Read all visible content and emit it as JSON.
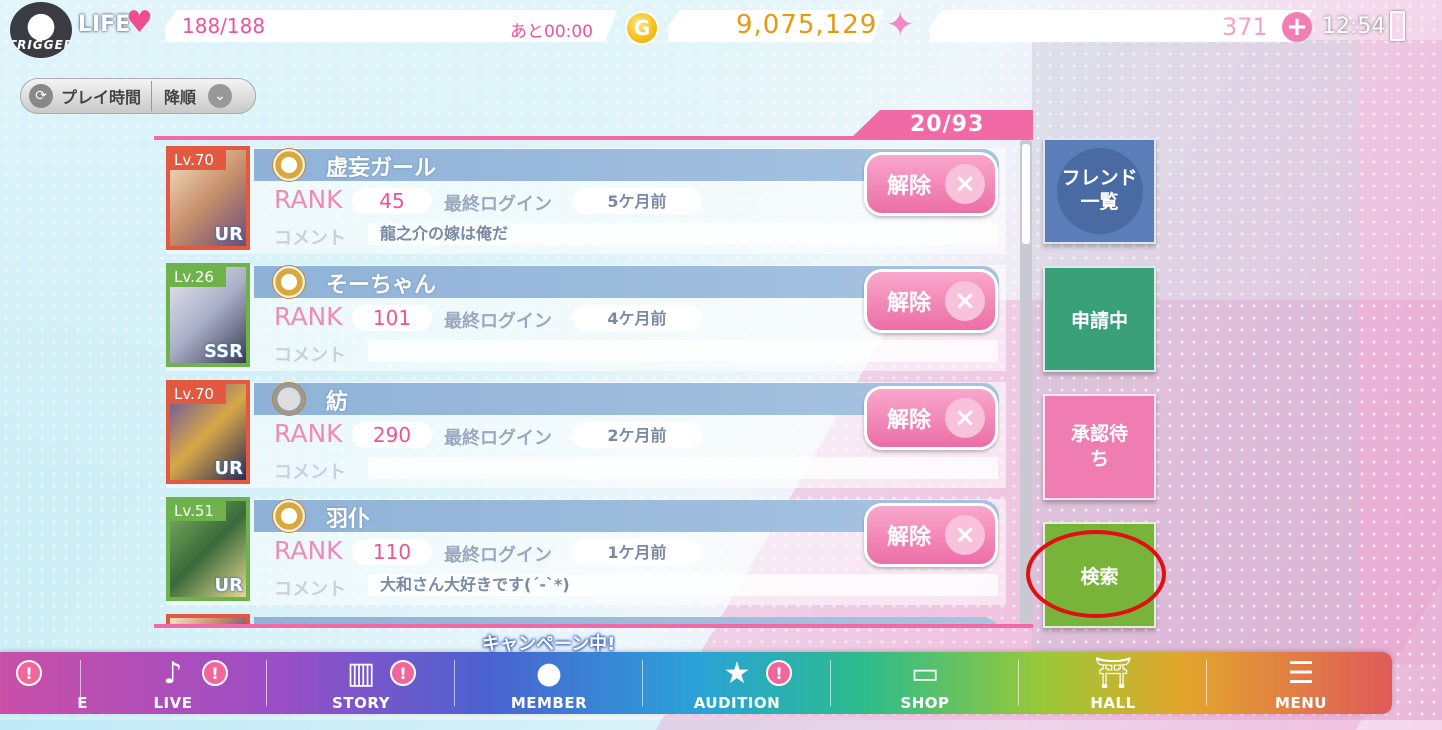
{
  "header": {
    "avatar_text": "TRIGGER",
    "life_label": "LIFE",
    "life_value": "188/188",
    "life_timer": "あと00:00",
    "gold_icon": "G",
    "gold": "9,075,129",
    "gems": "371",
    "gem_plus": "+",
    "clock": "12:54"
  },
  "sort": {
    "field_label": "プレイ時間",
    "order_label": "降順"
  },
  "list": {
    "counter": "20/93",
    "rank_label": "RANK",
    "login_label": "最終ログイン",
    "comment_label": "コメント",
    "remove_label": "解除",
    "remove_icon": "×",
    "friends": [
      {
        "level": "Lv.70",
        "rarity": "UR",
        "name": "虚妄ガール",
        "rank": "45",
        "last_login": "5ケ月前",
        "comment": "龍之介の嫁は俺だ"
      },
      {
        "level": "Lv.26",
        "rarity": "SSR",
        "name": "そーちゃん",
        "rank": "101",
        "last_login": "4ケ月前",
        "comment": ""
      },
      {
        "level": "Lv.70",
        "rarity": "UR",
        "name": "紡",
        "rank": "290",
        "last_login": "2ケ月前",
        "comment": ""
      },
      {
        "level": "Lv.51",
        "rarity": "UR",
        "name": "羽仆",
        "rank": "110",
        "last_login": "1ケ月前",
        "comment": "大和さん大好きです(´-`*)"
      }
    ]
  },
  "side": {
    "friends_list": "フレンド一覧",
    "applying": "申請中",
    "pending": "承認待ち",
    "search": "検索"
  },
  "nav": {
    "campaign": "キャンペーン中!",
    "badge": "!",
    "items": [
      {
        "label": "E"
      },
      {
        "label": "LIVE"
      },
      {
        "label": "STORY"
      },
      {
        "label": "MEMBER"
      },
      {
        "label": "AUDITION"
      },
      {
        "label": "SHOP"
      },
      {
        "label": "HALL"
      },
      {
        "label": "MENU"
      }
    ]
  },
  "colors": {
    "accent_pink": "#f26aa5",
    "name_band_blue": "#8fb2d8",
    "search_green": "#78b43a",
    "highlight_red": "#e01010"
  }
}
